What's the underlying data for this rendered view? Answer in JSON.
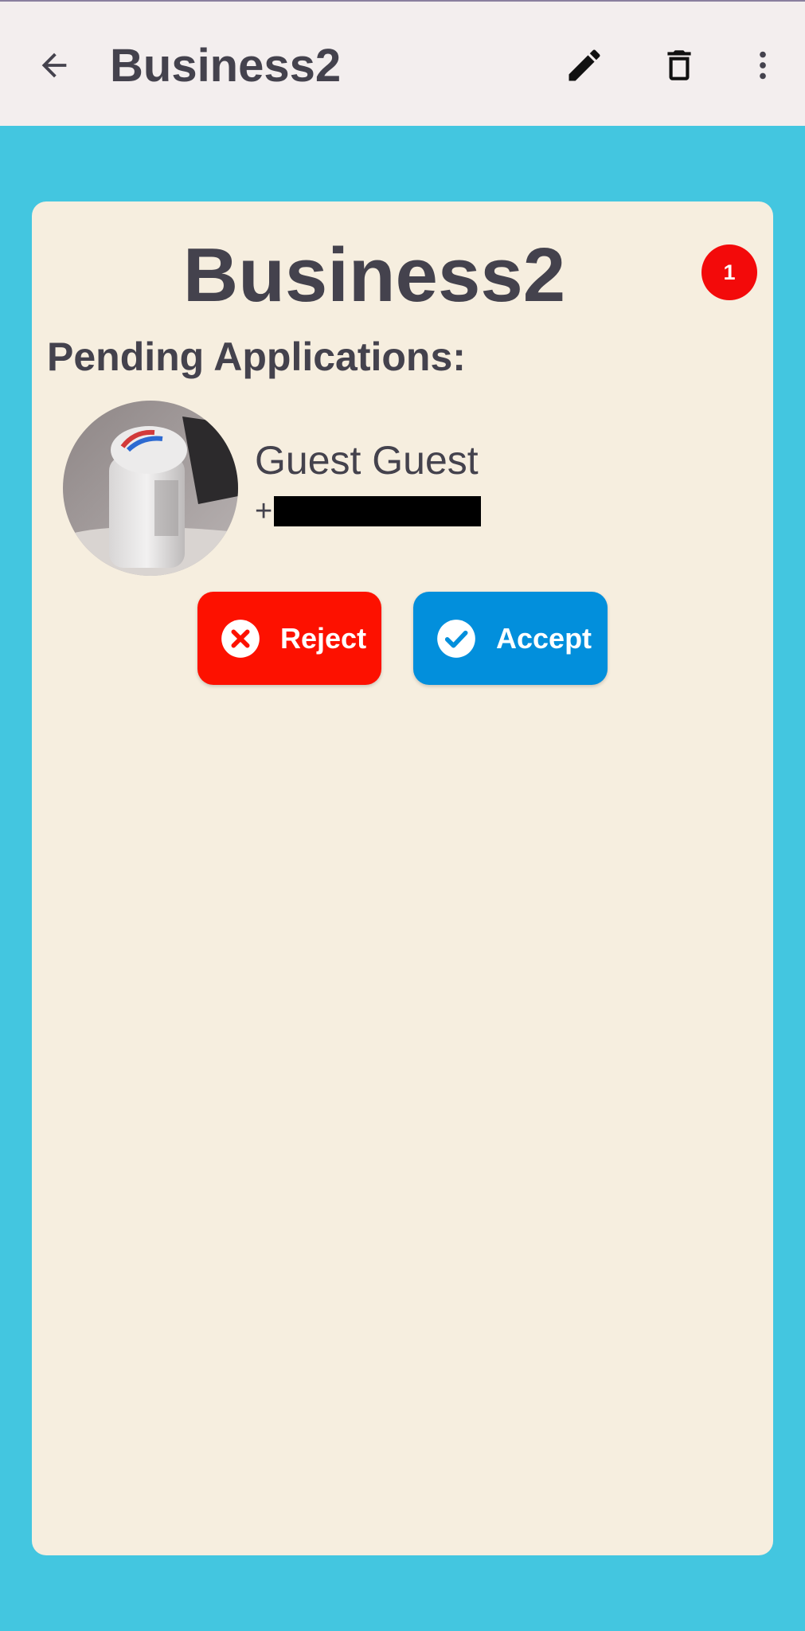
{
  "appbar": {
    "title": "Business2",
    "icons": [
      "back-arrow-icon",
      "pencil-icon",
      "trash-icon",
      "more-vert-icon"
    ]
  },
  "card": {
    "title": "Business2",
    "badge_count": "1",
    "section_title": "Pending Applications:",
    "applicant": {
      "name": "Guest Guest",
      "phone_prefix": "+"
    },
    "reject_label": "Reject",
    "accept_label": "Accept"
  },
  "colors": {
    "background": "#43c6e0",
    "appbar": "#f3eeee",
    "card": "#f6eedf",
    "text": "#44424d",
    "badge": "#f30a0a",
    "reject": "#fd1100",
    "accept": "#028fdc"
  }
}
